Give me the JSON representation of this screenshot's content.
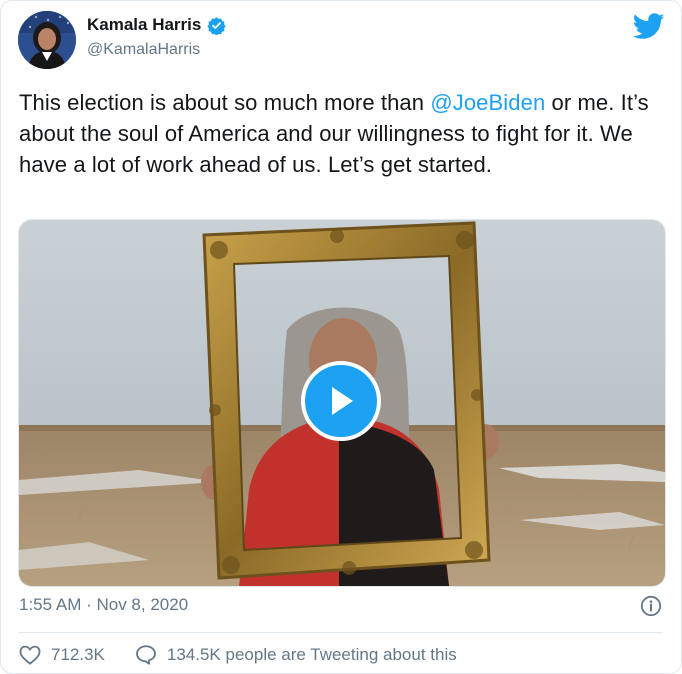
{
  "author": {
    "name": "Kamala Harris",
    "handle": "@KamalaHarris",
    "verified_icon": "verified-badge-icon",
    "avatar_icon": "avatar"
  },
  "brand": {
    "icon": "twitter-bird-icon",
    "color": "#1da1f2"
  },
  "tweet": {
    "text_before": "This election is about so much more than ",
    "mention": "@JoeBiden",
    "text_after": " or me. It’s about the soul of America and our willingness to fight for it. We have a lot of work ahead of us. Let’s get started."
  },
  "media": {
    "type": "video",
    "play_icon": "play-icon"
  },
  "timestamp": "1:55 AM · Nov 8, 2020",
  "info_icon": "info-icon",
  "actions": {
    "likes_count": "712.3K",
    "like_icon": "heart-icon",
    "reply_icon": "comment-icon",
    "tweeting_text": "134.5K people are Tweeting about this"
  },
  "colors": {
    "text": "#14171a",
    "secondary": "#657786",
    "accent": "#1da1f2",
    "border": "#e1e8ed"
  }
}
